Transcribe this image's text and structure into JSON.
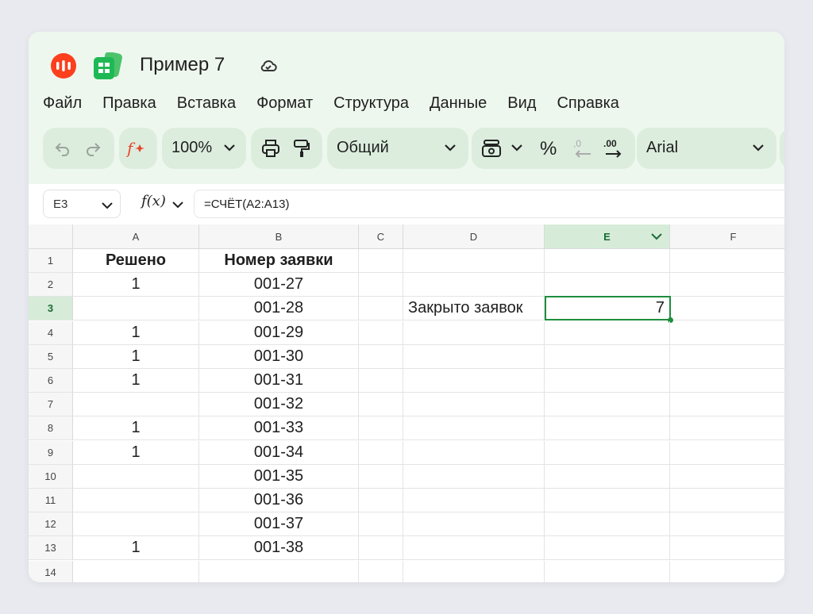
{
  "app": {
    "title": "Пример 7",
    "accent_color": "#1e8e3e",
    "brand_color": "#fc3f1d"
  },
  "menu": [
    "Файл",
    "Правка",
    "Вставка",
    "Формат",
    "Структура",
    "Данные",
    "Вид",
    "Справка"
  ],
  "toolbar": {
    "zoom": "100%",
    "number_format": "Общий",
    "percent_symbol": "%",
    "decimal_decrease_label": ",0",
    "decimal_increase_label": ".00",
    "font": "Arial"
  },
  "formula_bar": {
    "cell_ref": "E3",
    "fx_label": "f(x)",
    "formula": "=СЧЁТ(A2:A13)"
  },
  "sheet": {
    "columns": [
      "A",
      "B",
      "C",
      "D",
      "E",
      "F"
    ],
    "selected_column": "E",
    "selected_row": "3",
    "rows": [
      {
        "num": "1",
        "A": "Решено",
        "B": "Номер заявки",
        "D": "",
        "E": ""
      },
      {
        "num": "2",
        "A": "1",
        "B": "001-27",
        "D": "",
        "E": ""
      },
      {
        "num": "3",
        "A": "",
        "B": "001-28",
        "D": "Закрыто заявок",
        "E": "7"
      },
      {
        "num": "4",
        "A": "1",
        "B": "001-29",
        "D": "",
        "E": ""
      },
      {
        "num": "5",
        "A": "1",
        "B": "001-30",
        "D": "",
        "E": ""
      },
      {
        "num": "6",
        "A": "1",
        "B": "001-31",
        "D": "",
        "E": ""
      },
      {
        "num": "7",
        "A": "",
        "B": "001-32",
        "D": "",
        "E": ""
      },
      {
        "num": "8",
        "A": "1",
        "B": "001-33",
        "D": "",
        "E": ""
      },
      {
        "num": "9",
        "A": "1",
        "B": "001-34",
        "D": "",
        "E": ""
      },
      {
        "num": "10",
        "A": "",
        "B": "001-35",
        "D": "",
        "E": ""
      },
      {
        "num": "11",
        "A": "",
        "B": "001-36",
        "D": "",
        "E": ""
      },
      {
        "num": "12",
        "A": "",
        "B": "001-37",
        "D": "",
        "E": ""
      },
      {
        "num": "13",
        "A": "1",
        "B": "001-38",
        "D": "",
        "E": ""
      },
      {
        "num": "14",
        "A": "",
        "B": "",
        "D": "",
        "E": ""
      }
    ]
  }
}
